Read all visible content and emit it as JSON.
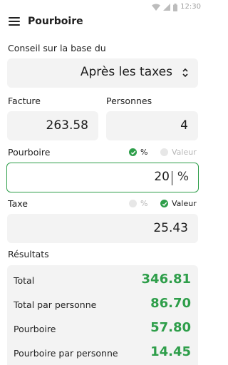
{
  "status": {
    "time": "12:30"
  },
  "app": {
    "title": "Pourboire"
  },
  "conseil": {
    "label": "Conseil sur la base du",
    "selected": "Après les taxes"
  },
  "facture": {
    "label": "Facture",
    "value": "263.58"
  },
  "personnes": {
    "label": "Personnes",
    "value": "4"
  },
  "pourboire": {
    "label": "Pourboire",
    "value": "20",
    "unit": "%",
    "options": [
      {
        "label": "%",
        "selected": true
      },
      {
        "label": "Valeur",
        "selected": false
      }
    ]
  },
  "taxe": {
    "label": "Taxe",
    "value": "25.43",
    "options": [
      {
        "label": "%",
        "selected": false
      },
      {
        "label": "Valeur",
        "selected": true
      }
    ]
  },
  "resultats": {
    "label": "Résultats",
    "rows": [
      {
        "label": "Total",
        "value": "346.81"
      },
      {
        "label": "Total par personne",
        "value": "86.70"
      },
      {
        "label": "Pourboire",
        "value": "57.80"
      },
      {
        "label": "Pourboire par personne",
        "value": "14.45"
      }
    ]
  },
  "colors": {
    "accent": "#2e9e4a",
    "field_bg": "#f3f3f3"
  }
}
